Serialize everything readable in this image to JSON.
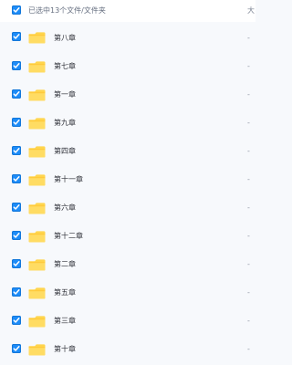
{
  "header": {
    "title": "已选中13个文件/文件夹",
    "size_label": "大",
    "select_all_icon": "checkbox-checked-icon"
  },
  "rows": [
    {
      "name": "第八章",
      "size": "-",
      "selected": true,
      "icon": "folder-icon"
    },
    {
      "name": "第七章",
      "size": "-",
      "selected": true,
      "icon": "folder-icon"
    },
    {
      "name": "第一章",
      "size": "-",
      "selected": true,
      "icon": "folder-icon"
    },
    {
      "name": "第九章",
      "size": "-",
      "selected": true,
      "icon": "folder-icon"
    },
    {
      "name": "第四章",
      "size": "-",
      "selected": true,
      "icon": "folder-icon"
    },
    {
      "name": "第十一章",
      "size": "-",
      "selected": true,
      "icon": "folder-icon"
    },
    {
      "name": "第六章",
      "size": "-",
      "selected": true,
      "icon": "folder-icon"
    },
    {
      "name": "第十二章",
      "size": "-",
      "selected": true,
      "icon": "folder-icon"
    },
    {
      "name": "第二章",
      "size": "-",
      "selected": true,
      "icon": "folder-icon"
    },
    {
      "name": "第五章",
      "size": "-",
      "selected": true,
      "icon": "folder-icon"
    },
    {
      "name": "第三章",
      "size": "-",
      "selected": true,
      "icon": "folder-icon"
    },
    {
      "name": "第十章",
      "size": "-",
      "selected": true,
      "icon": "folder-icon"
    }
  ],
  "colors": {
    "checkbox": "#1d8cf8",
    "folder": "#ffd54d",
    "background": "#f7f9fc"
  }
}
